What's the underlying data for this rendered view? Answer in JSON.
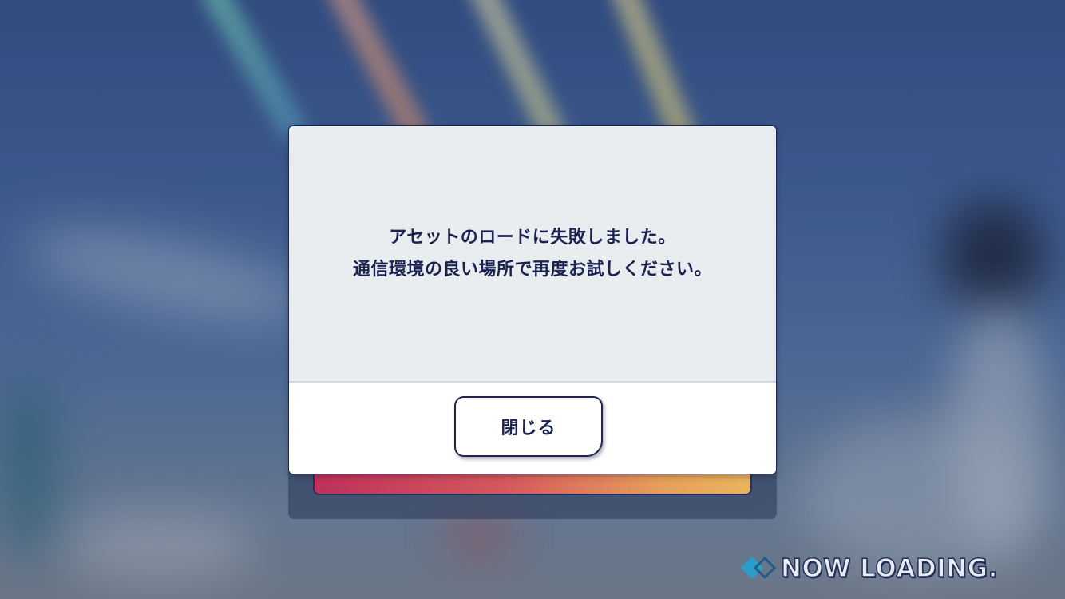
{
  "dialog": {
    "message_lines": [
      "アセットのロードに失敗しました。",
      "通信環境の良い場所で再度お試しください。"
    ],
    "close_label": "閉じる"
  },
  "loading_indicator": {
    "text": "NOW LOADING.",
    "icon": "double-diamond-icon"
  },
  "colors": {
    "dialog_text": "#1d2350",
    "dialog_body_bg": "#e9edf0",
    "dialog_footer_bg": "#ffffff",
    "button_border": "#1e2350",
    "loading_icon_accent": "#2a9ec8"
  }
}
